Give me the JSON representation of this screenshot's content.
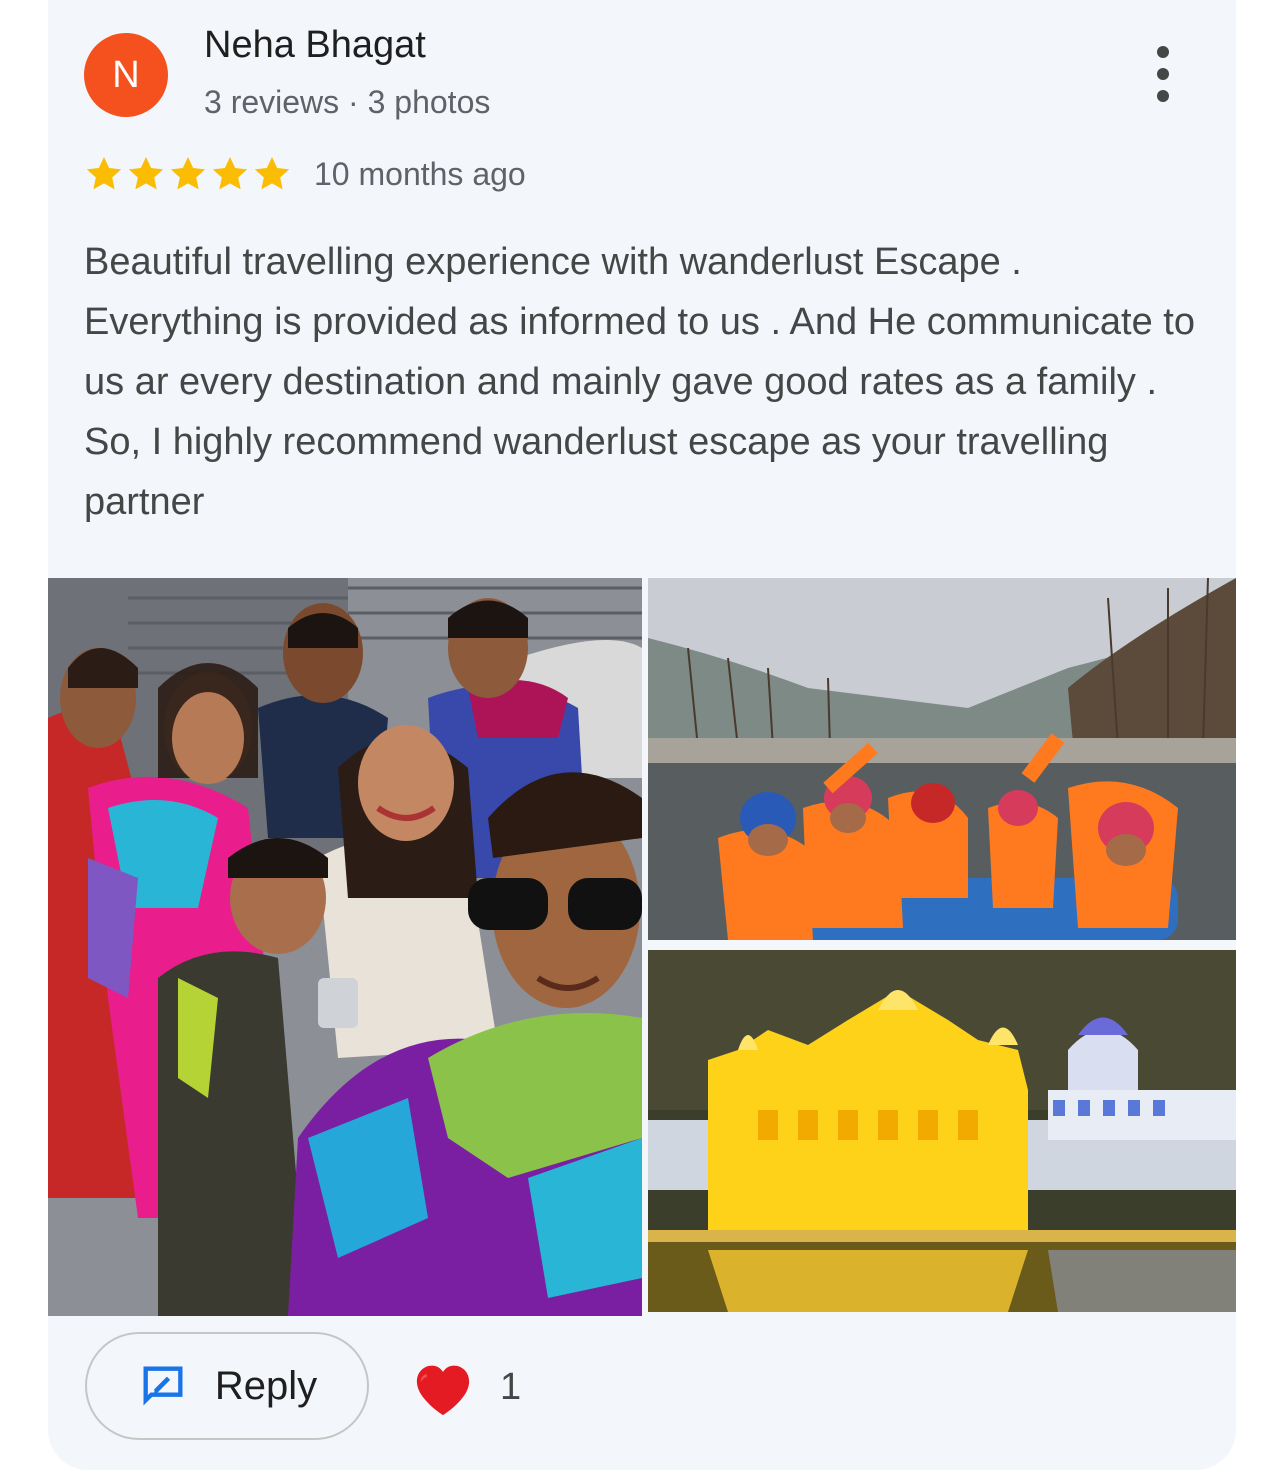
{
  "reviewer": {
    "initial": "N",
    "name": "Neha Bhagat",
    "meta": "3 reviews · 3 photos",
    "avatar_color": "#f4511e"
  },
  "review": {
    "rating": 5,
    "time": "10 months ago",
    "text": "Beautiful travelling experience with wanderlust Escape . Everything is provided as informed to us . And He communicate to us ar every destination and mainly gave good rates as a family . So, I highly recommend wanderlust escape as your travelling partner"
  },
  "photos": [
    {
      "subject": "group-selfie-photo"
    },
    {
      "subject": "river-rafting-photo"
    },
    {
      "subject": "golden-temple-night-photo"
    }
  ],
  "actions": {
    "reply_label": "Reply",
    "like_count": "1",
    "reply_icon": "reply-edit-icon",
    "like_icon": "heart-icon",
    "more_icon": "more-vert-icon"
  },
  "colors": {
    "star": "#fbbc04",
    "reply_icon": "#1a73e8",
    "heart": "#e51b23",
    "card_bg": "#f3f7fc"
  }
}
